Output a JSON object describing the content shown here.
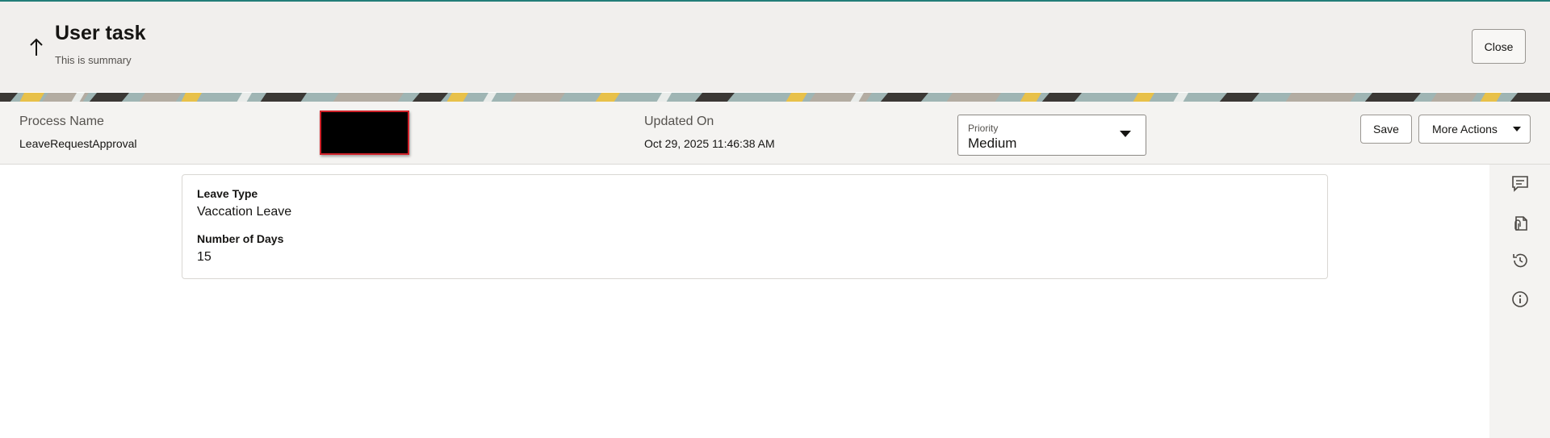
{
  "header": {
    "title": "User task",
    "subtitle": "This is summary",
    "close_label": "Close"
  },
  "info": {
    "process_name_label": "Process Name",
    "process_name_value": "LeaveRequestApproval",
    "updated_on_label": "Updated On",
    "updated_on_value": "Oct 29, 2025 11:46:38 AM",
    "priority": {
      "label": "Priority",
      "value": "Medium"
    },
    "save_label": "Save",
    "more_actions_label": "More Actions"
  },
  "form": {
    "fields": [
      {
        "label": "Leave Type",
        "value": "Vaccation Leave"
      },
      {
        "label": "Number of Days",
        "value": "15"
      }
    ]
  },
  "rail": {
    "icons": [
      "comment-icon",
      "attachment-icon",
      "history-icon",
      "info-icon"
    ]
  },
  "colors": {
    "accent_line": "#227e79",
    "header_bg": "#f1efed",
    "redaction": "#000000",
    "redaction_border": "#d0222a"
  }
}
